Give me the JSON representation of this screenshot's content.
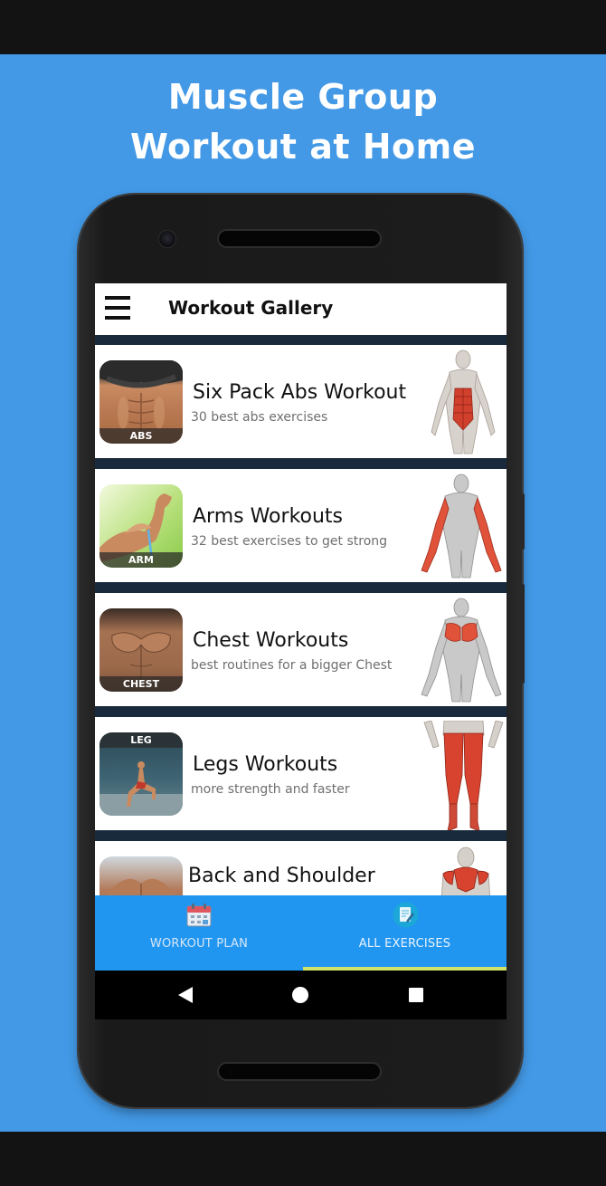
{
  "promo": {
    "title_line1": "Muscle Group",
    "title_line2": "Workout at Home",
    "background_color": "#4399e6"
  },
  "app": {
    "title": "Workout Gallery",
    "menu_icon": "hamburger-menu-icon"
  },
  "workouts": [
    {
      "title": "Six Pack Abs Workout",
      "subtitle": "30 best abs exercises",
      "badge": "ABS",
      "highlight": "abdominals"
    },
    {
      "title": "Arms Workouts",
      "subtitle": "32 best exercises to get strong",
      "badge": "ARM",
      "highlight": "arms"
    },
    {
      "title": "Chest Workouts",
      "subtitle": "best routines for a bigger Chest",
      "badge": "CHEST",
      "highlight": "chest"
    },
    {
      "title": "Legs Workouts",
      "subtitle": "more strength and faster",
      "badge": "LEG",
      "highlight": "legs"
    },
    {
      "title": "Back and Shoulder",
      "subtitle": "",
      "badge": "",
      "highlight": "back"
    }
  ],
  "bottom_nav": {
    "tabs": [
      {
        "label": "WORKOUT PLAN",
        "icon": "calendar-icon",
        "active": false
      },
      {
        "label": "ALL EXERCISES",
        "icon": "document-edit-icon",
        "active": true
      }
    ],
    "background_color": "#2196f0",
    "indicator_color": "#cfe36a"
  },
  "system_nav": {
    "buttons": [
      "back-icon",
      "home-icon",
      "recents-icon"
    ]
  }
}
